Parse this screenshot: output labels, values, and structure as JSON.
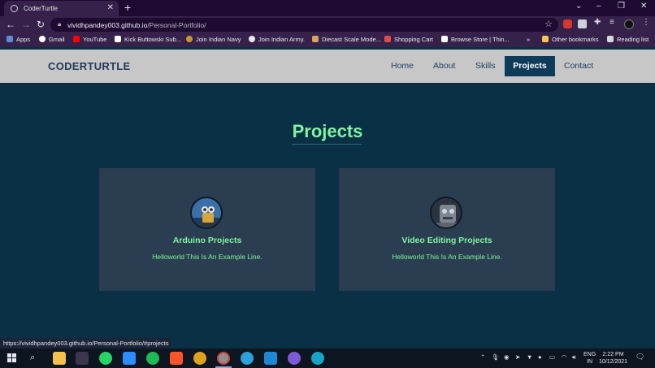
{
  "browser": {
    "tab_title": "CoderTurtle",
    "url_host": "vividhpandey003.github.io",
    "url_path": "/Personal-Portfolio/",
    "window_controls": [
      "⌄",
      "–",
      "❐",
      "✕"
    ]
  },
  "bookmarks": [
    {
      "label": "Apps",
      "icon": "apps-grid-icon",
      "color": "#5f8dd3"
    },
    {
      "label": "Gmail",
      "icon": "google-icon",
      "color": "#ffffff"
    },
    {
      "label": "YouTube",
      "icon": "youtube-icon",
      "color": "#ff0000"
    },
    {
      "label": "Kick Buttowski Sub...",
      "icon": "d-site-icon",
      "color": "#ffffff"
    },
    {
      "label": "Join Indian Navy",
      "icon": "navy-emblem-icon",
      "color": "#c79a2b"
    },
    {
      "label": "Join Indian Army.",
      "icon": "globe-icon",
      "color": "#e8e8e8"
    },
    {
      "label": "Diecast Scale Mode...",
      "icon": "diecast-icon",
      "color": "#d9a35a"
    },
    {
      "label": "Shopping Cart",
      "icon": "cart-icon",
      "color": "#e34b4b"
    },
    {
      "label": "Browse Store | Thin...",
      "icon": "store-icon",
      "color": "#ffffff"
    },
    {
      "label": "»",
      "icon": "",
      "color": ""
    },
    {
      "label": "Other bookmarks",
      "icon": "folder-icon",
      "color": "#f3c94c"
    },
    {
      "label": "Reading list",
      "icon": "reading-list-icon",
      "color": "#d7d7d7"
    }
  ],
  "site": {
    "brand": "CODERTURTLE",
    "nav": [
      "Home",
      "About",
      "Skills",
      "Projects",
      "Contact"
    ],
    "active_nav": "Projects",
    "section_title": "Projects",
    "projects": [
      {
        "title": "Arduino Projects",
        "description": "Helloworld This Is An Example Line."
      },
      {
        "title": "Video Editing Projects",
        "description": "Helloworld This Is An Example Line."
      }
    ]
  },
  "status_url": "https://vividhpandey003.github.io/Personal-Portfolio/#projects",
  "taskbar": {
    "language": "ENG",
    "region": "IN",
    "time": "2:22 PM",
    "date": "10/12/2021"
  },
  "colors": {
    "accent_green": "#7ff5a0",
    "page_bg": "#0a3046",
    "card_bg": "#2b3d50",
    "nav_bg": "#c7c7c7",
    "active_nav_bg": "#0d3b59"
  }
}
